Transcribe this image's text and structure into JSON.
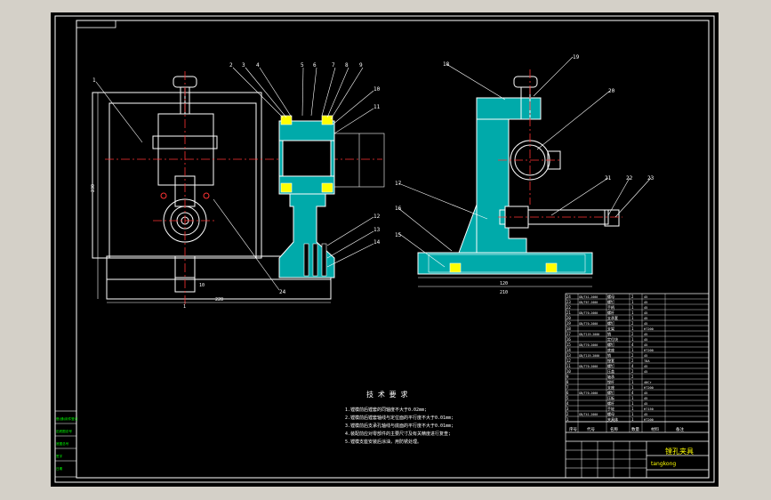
{
  "colors": {
    "background": "#d4d0c8",
    "paper": "#000000",
    "line": "#ffffff",
    "body": "#00cccc",
    "hatch": "#00aaaa",
    "centerline": "#ff3333",
    "dim": "#ffffff",
    "text_yellow": "#ffff00",
    "text_green": "#00ff00"
  },
  "front_view": {
    "part_numbers": [
      "1",
      "2",
      "3",
      "4",
      "5",
      "6",
      "7",
      "8",
      "9",
      "10",
      "11",
      "12",
      "13",
      "14",
      "24"
    ],
    "dimensions": [
      "230",
      "228",
      "10",
      "1"
    ]
  },
  "side_view": {
    "part_numbers": [
      "15",
      "16",
      "17",
      "18",
      "19",
      "20",
      "21",
      "22",
      "23"
    ],
    "dimensions": [
      "120",
      "210"
    ]
  },
  "tech_requirements": {
    "title": "技 术 要 求",
    "items": [
      "1.镗模前后镗套的同轴度不大于0.02mm;",
      "2.镗模前后镗套轴线与定位面的平行度不大于0.01mm;",
      "3.镗模前后支承孔轴线与底面的平行度不大于0.01mm;",
      "4.装配前应对零部件的主要尺寸及有关精度进行复查;",
      "5.镗模支座安装后涂油，用防锈处理。"
    ]
  },
  "title_block": {
    "drawing_name": "镗孔夹具",
    "drawing_code": "tangkong",
    "header_cells": [
      "序号",
      "代号",
      "名称",
      "数量",
      "材料",
      "备注"
    ],
    "parts": [
      {
        "no": "24",
        "code": "GB/T41-2000",
        "name": "螺母",
        "qty": "2",
        "mat": "45"
      },
      {
        "no": "23",
        "code": "GB/T67-2000",
        "name": "螺钉",
        "qty": "1",
        "mat": "45"
      },
      {
        "no": "22",
        "code": "",
        "name": "手柄",
        "qty": "1",
        "mat": "45"
      },
      {
        "no": "21",
        "code": "GB/T70-2000",
        "name": "螺杆",
        "qty": "1",
        "mat": "45"
      },
      {
        "no": "20",
        "code": "",
        "name": "支承套",
        "qty": "1",
        "mat": "45"
      },
      {
        "no": "19",
        "code": "GB/T70-2000",
        "name": "螺钉",
        "qty": "2",
        "mat": "45"
      },
      {
        "no": "18",
        "code": "",
        "name": "支架",
        "qty": "1",
        "mat": "HT200"
      },
      {
        "no": "17",
        "code": "GB/T119-2000",
        "name": "销",
        "qty": "2",
        "mat": "45"
      },
      {
        "no": "16",
        "code": "",
        "name": "定位块",
        "qty": "1",
        "mat": "45"
      },
      {
        "no": "15",
        "code": "GB/T70-2000",
        "name": "螺钉",
        "qty": "4",
        "mat": "45"
      },
      {
        "no": "14",
        "code": "",
        "name": "底座",
        "qty": "1",
        "mat": "HT200"
      },
      {
        "no": "13",
        "code": "GB/T119-2000",
        "name": "销",
        "qty": "2",
        "mat": "45"
      },
      {
        "no": "12",
        "code": "",
        "name": "镗套",
        "qty": "2",
        "mat": "T8A"
      },
      {
        "no": "11",
        "code": "GB/T70-2000",
        "name": "螺钉",
        "qty": "4",
        "mat": "45"
      },
      {
        "no": "10",
        "code": "",
        "name": "压盖",
        "qty": "2",
        "mat": "45"
      },
      {
        "no": "9",
        "code": "",
        "name": "轴承",
        "qty": "2",
        "mat": ""
      },
      {
        "no": "8",
        "code": "",
        "name": "镗杆",
        "qty": "1",
        "mat": "40Cr"
      },
      {
        "no": "7",
        "code": "",
        "name": "支座",
        "qty": "1",
        "mat": "HT200"
      },
      {
        "no": "6",
        "code": "GB/T70-2000",
        "name": "螺钉",
        "qty": "4",
        "mat": "45"
      },
      {
        "no": "5",
        "code": "",
        "name": "压板",
        "qty": "1",
        "mat": "45"
      },
      {
        "no": "4",
        "code": "",
        "name": "螺杆",
        "qty": "1",
        "mat": "45"
      },
      {
        "no": "3",
        "code": "",
        "name": "手轮",
        "qty": "1",
        "mat": "HT150"
      },
      {
        "no": "2",
        "code": "GB/T41-2000",
        "name": "螺母",
        "qty": "1",
        "mat": "45"
      },
      {
        "no": "1",
        "code": "",
        "name": "夹具体",
        "qty": "1",
        "mat": "HT200"
      }
    ]
  },
  "left_strip": {
    "cells": [
      "借(通)用件登记",
      "旧底图总号",
      "底图总号",
      "签字",
      "日期"
    ]
  }
}
